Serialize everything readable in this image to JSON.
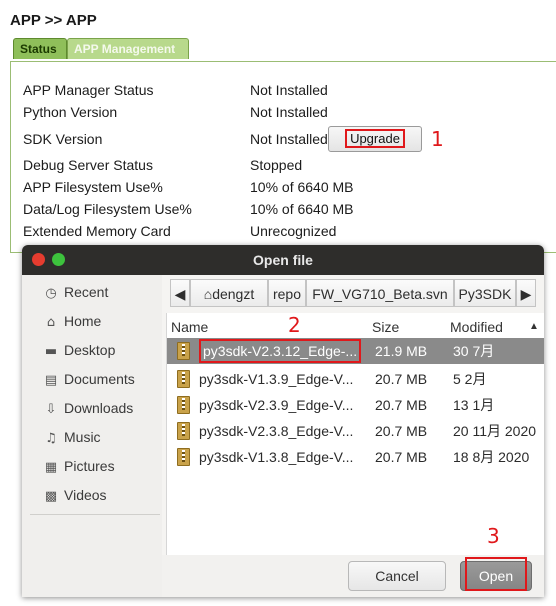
{
  "breadcrumb": "APP >> APP",
  "tabs": [
    "Status",
    "APP Management"
  ],
  "status_rows": [
    {
      "label": "APP Manager Status",
      "value": "Not Installed"
    },
    {
      "label": "Python Version",
      "value": "Not Installed"
    },
    {
      "label": "SDK Version",
      "value": "Not Installed"
    },
    {
      "label": "Debug Server Status",
      "value": "Stopped"
    },
    {
      "label": "APP Filesystem Use%",
      "value": "10% of 6640 MB"
    },
    {
      "label": "Data/Log Filesystem Use%",
      "value": "10% of 6640 MB"
    },
    {
      "label": "Extended Memory Card",
      "value": "Unrecognized"
    }
  ],
  "upgrade_label": "Upgrade",
  "annotations": [
    "1",
    "2",
    "3"
  ],
  "dialog": {
    "title": "Open file",
    "sidebar": [
      {
        "label": "Recent",
        "icon": "clock-icon"
      },
      {
        "label": "Home",
        "icon": "home-icon"
      },
      {
        "label": "Desktop",
        "icon": "folder-icon"
      },
      {
        "label": "Documents",
        "icon": "document-icon"
      },
      {
        "label": "Downloads",
        "icon": "download-icon"
      },
      {
        "label": "Music",
        "icon": "music-icon"
      },
      {
        "label": "Pictures",
        "icon": "image-icon"
      },
      {
        "label": "Videos",
        "icon": "film-icon"
      }
    ],
    "path": [
      "dengzt",
      "repo",
      "FW_VG710_Beta.svn",
      "Py3SDK"
    ],
    "columns": {
      "name": "Name",
      "size": "Size",
      "modified": "Modified"
    },
    "files": [
      {
        "name": "py3sdk-V2.3.12_Edge-...",
        "size": "21.9 MB",
        "modified": "30 7月"
      },
      {
        "name": "py3sdk-V1.3.9_Edge-V...",
        "size": "20.7 MB",
        "modified": "5 2月"
      },
      {
        "name": "py3sdk-V2.3.9_Edge-V...",
        "size": "20.7 MB",
        "modified": "13 1月"
      },
      {
        "name": "py3sdk-V2.3.8_Edge-V...",
        "size": "20.7 MB",
        "modified": "20 11月 2020"
      },
      {
        "name": "py3sdk-V1.3.8_Edge-V...",
        "size": "20.7 MB",
        "modified": "18 8月 2020"
      }
    ],
    "cancel_label": "Cancel",
    "open_label": "Open"
  },
  "colors": {
    "annotation_red": "#e0181b",
    "tab_green": "#8fbf5a",
    "titlebar": "#2e2d2b"
  }
}
